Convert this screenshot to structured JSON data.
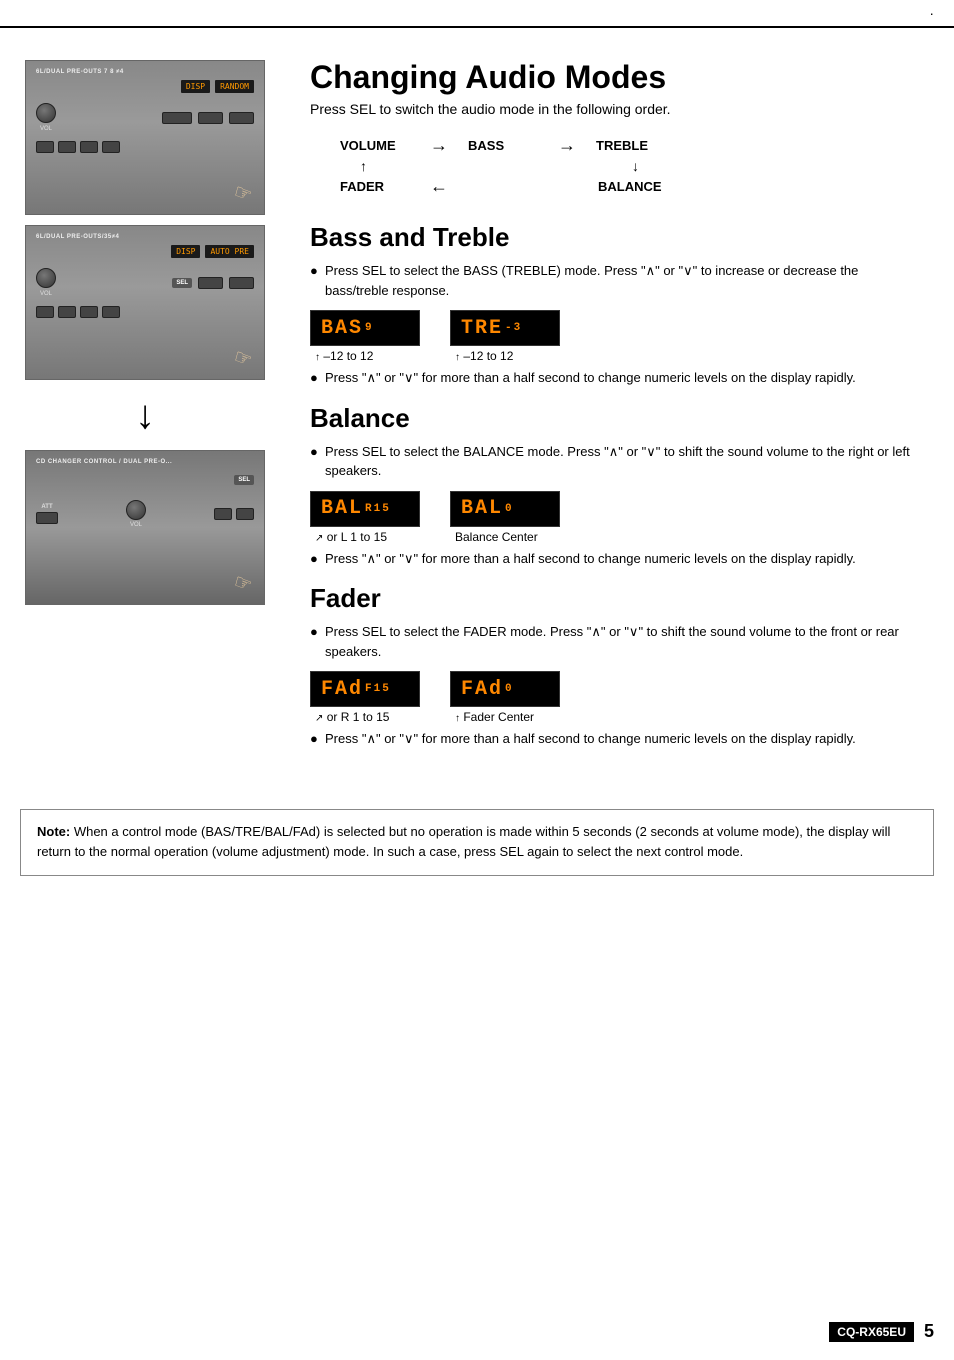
{
  "page": {
    "number": "5",
    "model": "CQ-RX65EU"
  },
  "top_dot": "·",
  "sections": {
    "changing_audio": {
      "title": "Changing Audio Modes",
      "subtitle": "Press SEL to switch the audio mode in the following order.",
      "modes": {
        "volume": "VOLUME",
        "arrow_right1": "→",
        "bass": "BASS",
        "arrow_right2": "→",
        "treble": "TREBLE",
        "arrow_up": "↑",
        "fader": "FADER",
        "arrow_left": "←",
        "balance": "BALANCE",
        "arrow_down": "↓"
      }
    },
    "bass_treble": {
      "title": "Bass and Treble",
      "bullet1": "Press SEL to select the BASS (TREBLE) mode. Press \"∧\" or \"∨\" to increase or decrease the bass/treble response.",
      "display1_text": "BAS",
      "display1_val": "9",
      "display2_text": "TRE",
      "display2_val": "-3",
      "range1": "–12 to 12",
      "range2": "–12 to 12",
      "bullet2": "Press \"∧\" or \"∨\" for more than a half second to change numeric levels on the display rapidly."
    },
    "balance": {
      "title": "Balance",
      "bullet1": "Press SEL to select the BALANCE mode. Press \"∧\" or \"∨\" to shift the sound volume to the right or left speakers.",
      "display1_text": "BAL",
      "display1_val": "R15",
      "display2_text": "BAL",
      "display2_val": "0",
      "range1": "or L  1 to 15",
      "range2": "Balance Center",
      "bullet2": "Press \"∧\" or \"∨\" for more than a half second to change numeric levels on the display rapidly."
    },
    "fader": {
      "title": "Fader",
      "bullet1": "Press SEL to select the FADER mode. Press \"∧\" or \"∨\" to shift the sound volume to the front or rear speakers.",
      "display1_text": "FAd",
      "display1_val": "F15",
      "display2_text": "FAd",
      "display2_val": "0",
      "range1": "or R   1 to 15",
      "range2": "Fader Center",
      "bullet2": "Press \"∧\" or \"∨\" for more than a half second to change numeric levels on the display rapidly."
    }
  },
  "note": {
    "label": "Note:",
    "text": " When a control mode (BAS/TRE/BAL/FAd) is selected but no operation is made within 5 seconds (2 seconds at volume mode), the display will return to the normal operation (volume adjustment) mode. In such a case, press SEL again to select the next control mode."
  },
  "images": {
    "img1_label": "6L/DUAL PRE-OUTS 7 8 ≠4",
    "img2_label": "6L/DUAL PRE-OUTS/35≠4",
    "img3_label": "CD CHANGER CONTROL / DUAL PRE-O..."
  }
}
